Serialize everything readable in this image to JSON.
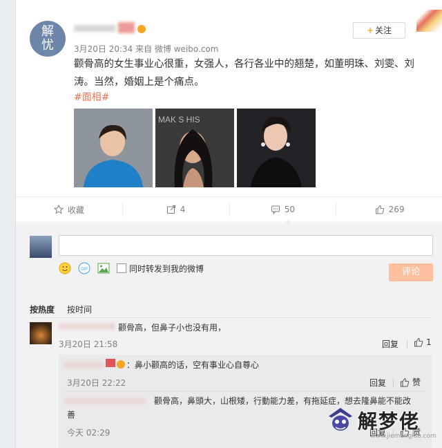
{
  "post": {
    "avatar_text_1": "解",
    "avatar_text_2": "忧",
    "meta": "3月20日 20:34 来自 微博 weibo.com",
    "follow_label": "关注",
    "follow_plus": "+",
    "text": "颧骨高的女生事业心很重，女强人，各行各业中的翘楚，如董明珠、刘雯、刘涛。当然，婚姻上是个痛点。",
    "hashtag": "#面相#",
    "photo2_overlay": "MAK    S HIS"
  },
  "actions": [
    {
      "icon": "star-icon",
      "label": "收藏"
    },
    {
      "icon": "share-icon",
      "label": "4"
    },
    {
      "icon": "comment-icon",
      "label": "50"
    },
    {
      "icon": "like-icon",
      "label": "269"
    }
  ],
  "composer": {
    "input_value": "",
    "gif_label": "GIF",
    "repost_label": "同时转发到我的微博",
    "submit_label": "评论"
  },
  "sort": {
    "hot": "按热度",
    "time": "按时间"
  },
  "comments": [
    {
      "text": "颧骨高，但鼻子小也没有用，",
      "time": "3月20日 21:58",
      "reply": "回复",
      "likes": "1"
    }
  ],
  "sub_comments": [
    {
      "text": "：鼻小颧高的话，空有事业心自尊心",
      "time": "3月20日 22:22",
      "reply": "回复",
      "like_label": "赞"
    },
    {
      "text": "颧骨高，鼻頭大，山根矮，行動能力差，有拖延症，想去隆鼻能不能改",
      "text_cont": "善",
      "time": "今天 02:29",
      "reply": "回复",
      "like_label": "赞"
    }
  ],
  "watermark": {
    "text": "解梦佬",
    "url": "www.jiemenglao.com"
  },
  "colors": {
    "accent": "#ff8200",
    "hashtag": "#eb7350",
    "submit_bg": "#ffc09f",
    "avatar_bg": "#6f86ab"
  }
}
